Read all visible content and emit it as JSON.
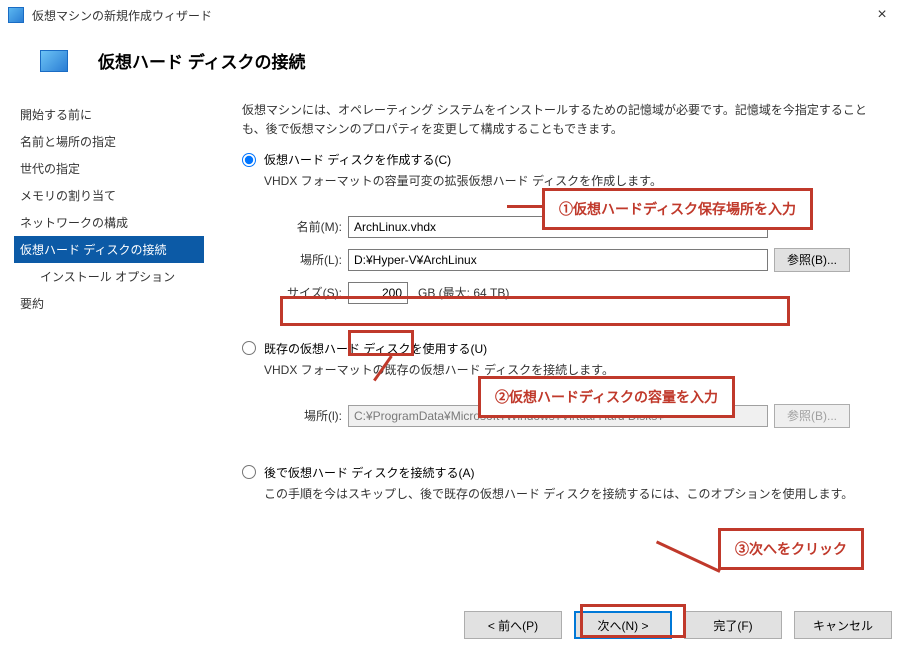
{
  "window": {
    "title": "仮想マシンの新規作成ウィザード",
    "close_glyph": "×"
  },
  "page_heading": "仮想ハード ディスクの接続",
  "sidebar": {
    "items": [
      {
        "label": "開始する前に",
        "active": false
      },
      {
        "label": "名前と場所の指定",
        "active": false
      },
      {
        "label": "世代の指定",
        "active": false
      },
      {
        "label": "メモリの割り当て",
        "active": false
      },
      {
        "label": "ネットワークの構成",
        "active": false
      },
      {
        "label": "仮想ハード ディスクの接続",
        "active": true
      },
      {
        "label": "インストール オプション",
        "active": false,
        "child": true
      },
      {
        "label": "要約",
        "active": false
      }
    ]
  },
  "intro": "仮想マシンには、オペレーティング システムをインストールするための記憶域が必要です。記憶域を今指定することも、後で仮想マシンのプロパティを変更して構成することもできます。",
  "option1": {
    "label": "仮想ハード ディスクを作成する(C)",
    "desc": "VHDX フォーマットの容量可変の拡張仮想ハード ディスクを作成します。",
    "name_label": "名前(M):",
    "name_value": "ArchLinux.vhdx",
    "loc_label": "場所(L):",
    "loc_value": "D:¥Hyper-V¥ArchLinux",
    "browse_label": "参照(B)...",
    "size_label": "サイズ(S):",
    "size_value": "200",
    "size_after": "GB (最大: 64 TB)"
  },
  "option2": {
    "label": "既存の仮想ハード ディスクを使用する(U)",
    "desc": "VHDX フォーマットの既存の仮想ハード ディスクを接続します。",
    "loc_label": "場所(l):",
    "loc_value": "C:¥ProgramData¥Microsoft¥Windows¥Virtual Hard Disks¥",
    "browse_label": "参照(B)..."
  },
  "option3": {
    "label": "後で仮想ハード ディスクを接続する(A)",
    "desc": "この手順を今はスキップし、後で既存の仮想ハード ディスクを接続するには、このオプションを使用します。"
  },
  "footer": {
    "prev": "< 前へ(P)",
    "next": "次へ(N) >",
    "finish": "完了(F)",
    "cancel": "キャンセル"
  },
  "callouts": {
    "c1": "①仮想ハードディスク保存場所を入力",
    "c2": "②仮想ハードディスクの容量を入力",
    "c3": "③次へをクリック"
  },
  "radio_selected": "create"
}
